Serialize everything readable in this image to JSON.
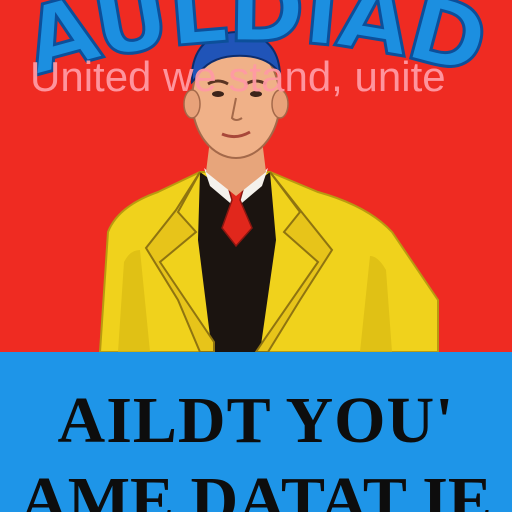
{
  "poster": {
    "headline": "AULDIAD",
    "slogan": "United we stand, unite",
    "banner_line1": "AILDT YOU'",
    "banner_line2": "AME DATAT IE"
  },
  "colors": {
    "background_red": "#ef2b22",
    "headline_blue": "#1c8fe0",
    "banner_blue": "#1e95e8",
    "jacket_yellow": "#f0d21c",
    "slogan_pink": "#ff9aa4",
    "text_black": "#0d0d0d"
  }
}
